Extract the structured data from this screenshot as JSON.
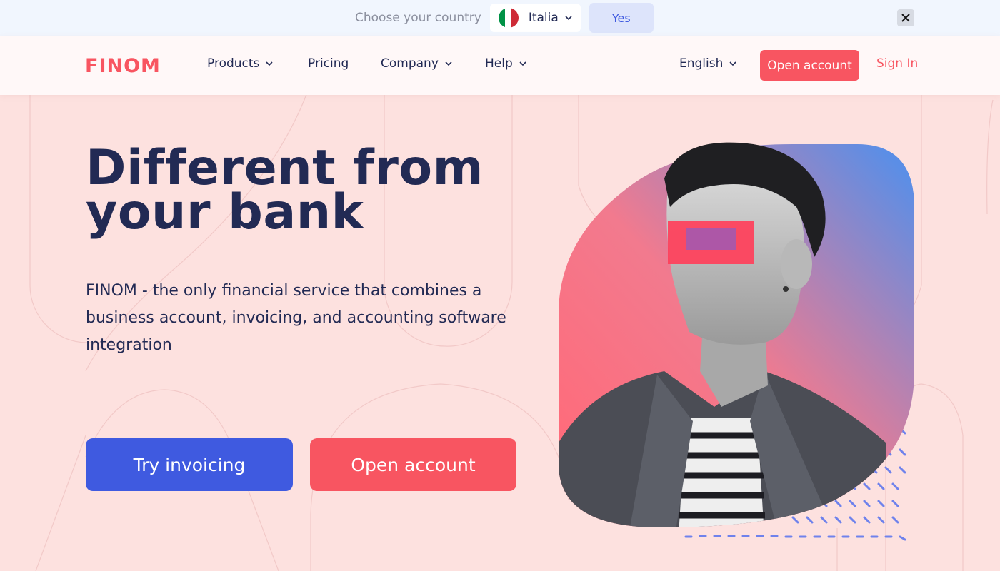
{
  "country_banner": {
    "prompt": "Choose your country",
    "selected_country": "Italia",
    "confirm_label": "Yes",
    "flag_colors": [
      "#009246",
      "#ffffff",
      "#ce2b37"
    ]
  },
  "header": {
    "logo_text": "FINOM",
    "nav": [
      {
        "label": "Products",
        "has_dropdown": true
      },
      {
        "label": "Pricing",
        "has_dropdown": false
      },
      {
        "label": "Company",
        "has_dropdown": true
      },
      {
        "label": "Help",
        "has_dropdown": true
      }
    ],
    "language": "English",
    "cta_label": "Open account",
    "signin_label": "Sign In"
  },
  "hero": {
    "title_line1": "Different from",
    "title_line2": "your bank",
    "subtitle": "FINOM - the only financial service that combines a business account, invoicing, and accounting software integration",
    "primary_button": "Try invoicing",
    "secondary_button": "Open account"
  },
  "colors": {
    "accent_red": "#f85561",
    "accent_blue": "#3f5ae0",
    "text_navy": "#222a54",
    "page_bg": "#fde1df"
  },
  "icons": {
    "dropdown": "chevron-down-icon",
    "close": "close-icon"
  }
}
